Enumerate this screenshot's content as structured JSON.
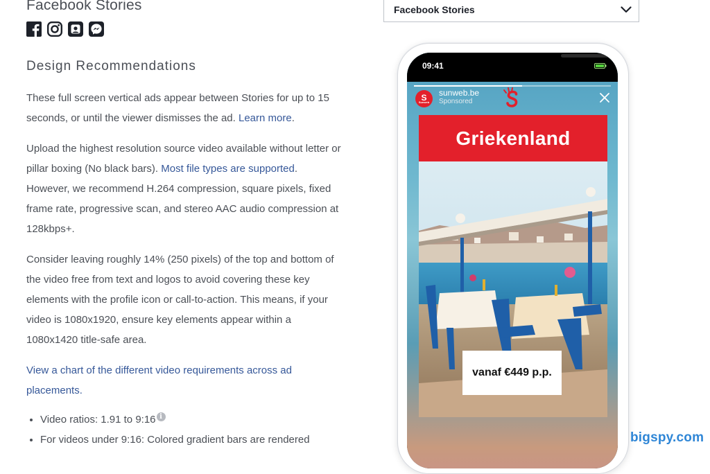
{
  "page": {
    "title": "Facebook Stories"
  },
  "social_icons": [
    "facebook-icon",
    "instagram-icon",
    "audience-network-icon",
    "messenger-icon"
  ],
  "section": {
    "heading": "Design Recommendations"
  },
  "paragraphs": {
    "p1_text": "These full screen vertical ads appear between Stories for up to 15 seconds, or until the viewer dismisses the ad.",
    "p1_link": "Learn more",
    "p2_text_a": "Upload the highest resolution source video available without letter or pillar boxing (No black bars).",
    "p2_link": "Most file types are supported",
    "p2_text_b": ". However, we recommend H.264 compression, square pixels, fixed frame rate, progressive scan, and stereo AAC audio compression at 128kbps+.",
    "p3_text": "Consider leaving roughly 14% (250 pixels) of the top and bottom of the video free from text and logos to avoid covering these key elements with the profile icon or call-to-action. This means, if your video is 1080x1920, ensure key elements appear within a 1080x1420 title-safe area.",
    "p4_link": "View a chart of the different video requirements across ad placements."
  },
  "specs": [
    "Video ratios: 1.91 to 9:16",
    "For videos under 9:16: Colored gradient bars are rendered"
  ],
  "info_glyph": "i",
  "placement_select": {
    "selected": "Facebook Stories"
  },
  "phone": {
    "time": "09:41",
    "story_progress": 0.55,
    "brand_initial": "S",
    "brand_tiny": "Sunweb",
    "brand_name": "sunweb.be",
    "sponsored": "Sponsored",
    "headline": "Griekenland",
    "price": "vanaf €449 p.p."
  },
  "colors": {
    "link": "#365899",
    "brand_red": "#e3202b",
    "watermark": "#2f86d6"
  },
  "watermark": "bigspy.com"
}
